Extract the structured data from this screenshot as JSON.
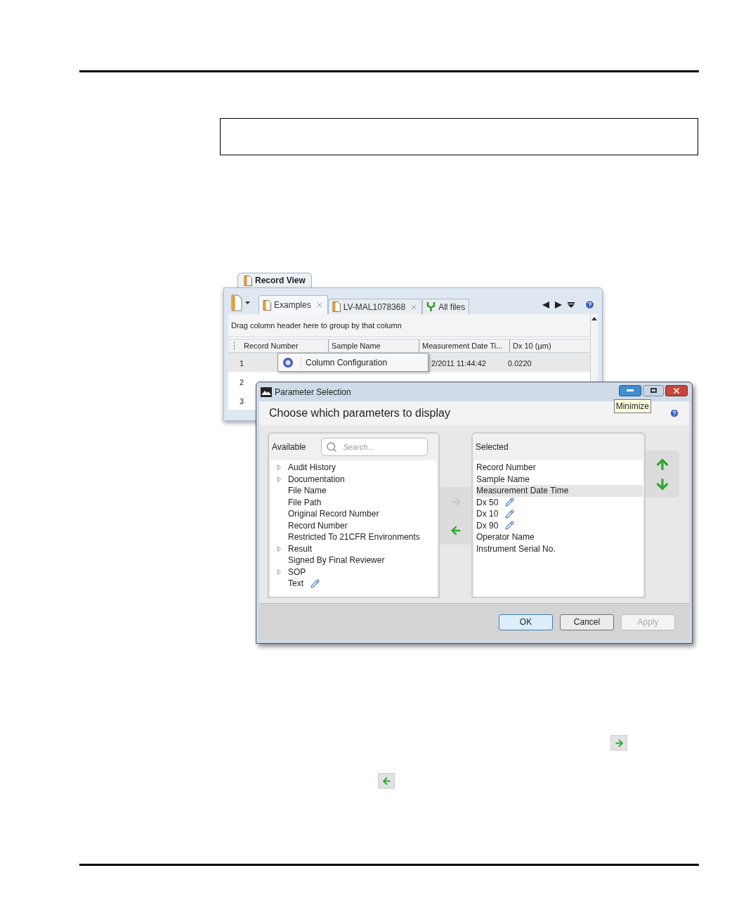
{
  "record_view": {
    "title": "Record View",
    "tabs": [
      {
        "label": "Examples",
        "selected": true,
        "closable": true
      },
      {
        "label": "LV-MAL1078368",
        "selected": false,
        "closable": true
      },
      {
        "label": "All files",
        "selected": false,
        "closable": false
      }
    ],
    "group_hint": "Drag column header here to group by that column",
    "columns": [
      "Record Number",
      "Sample Name",
      "Measurement Date Ti...",
      "Dx 10 (µm)"
    ],
    "rows": [
      {
        "cells": [
          "1",
          "",
          "2/2011 11:44:42",
          "0.0220"
        ],
        "selected": true
      },
      {
        "cells": [
          "2",
          "",
          "",
          ""
        ],
        "selected": false
      },
      {
        "cells": [
          "3",
          "",
          "",
          ""
        ],
        "selected": false
      }
    ],
    "context_menu": {
      "items": [
        "Column Configuration"
      ]
    }
  },
  "dialog": {
    "title": "Parameter Selection",
    "tooltip": "Minimize",
    "heading": "Choose which parameters to display",
    "available": {
      "label": "Available",
      "search_placeholder": "Search...",
      "items": [
        {
          "label": "Audit History",
          "expandable": true,
          "editable": false
        },
        {
          "label": "Documentation",
          "expandable": true,
          "editable": false
        },
        {
          "label": "File Name",
          "expandable": false,
          "editable": false
        },
        {
          "label": "File Path",
          "expandable": false,
          "editable": false
        },
        {
          "label": "Original Record Number",
          "expandable": false,
          "editable": false
        },
        {
          "label": "Record Number",
          "expandable": false,
          "editable": false
        },
        {
          "label": "Restricted To 21CFR Environments",
          "expandable": false,
          "editable": false
        },
        {
          "label": "Result",
          "expandable": true,
          "editable": false
        },
        {
          "label": "Signed By Final Reviewer",
          "expandable": false,
          "editable": false
        },
        {
          "label": "SOP",
          "expandable": true,
          "editable": false
        },
        {
          "label": "Text",
          "expandable": false,
          "editable": true
        }
      ]
    },
    "transfer": [
      {
        "kind": "add",
        "disabled": true
      },
      {
        "kind": "remove",
        "disabled": false
      }
    ],
    "selected": {
      "label": "Selected",
      "items": [
        {
          "label": "Record Number",
          "selected": false,
          "editable": false
        },
        {
          "label": "Sample Name",
          "selected": false,
          "editable": false
        },
        {
          "label": "Measurement Date Time",
          "selected": true,
          "editable": false
        },
        {
          "label": "Dx 50",
          "selected": false,
          "editable": true
        },
        {
          "label": "Dx 10",
          "selected": false,
          "editable": true
        },
        {
          "label": "Dx 90",
          "selected": false,
          "editable": true
        },
        {
          "label": "Operator Name",
          "selected": false,
          "editable": false
        },
        {
          "label": "Instrument Serial No.",
          "selected": false,
          "editable": false
        }
      ]
    },
    "actions": [
      {
        "label": "OK",
        "default": true,
        "disabled": false
      },
      {
        "label": "Cancel",
        "default": false,
        "disabled": false
      },
      {
        "label": "Apply",
        "default": false,
        "disabled": true
      }
    ]
  },
  "page_icons": [
    {
      "kind": "add"
    },
    {
      "kind": "remove"
    }
  ]
}
